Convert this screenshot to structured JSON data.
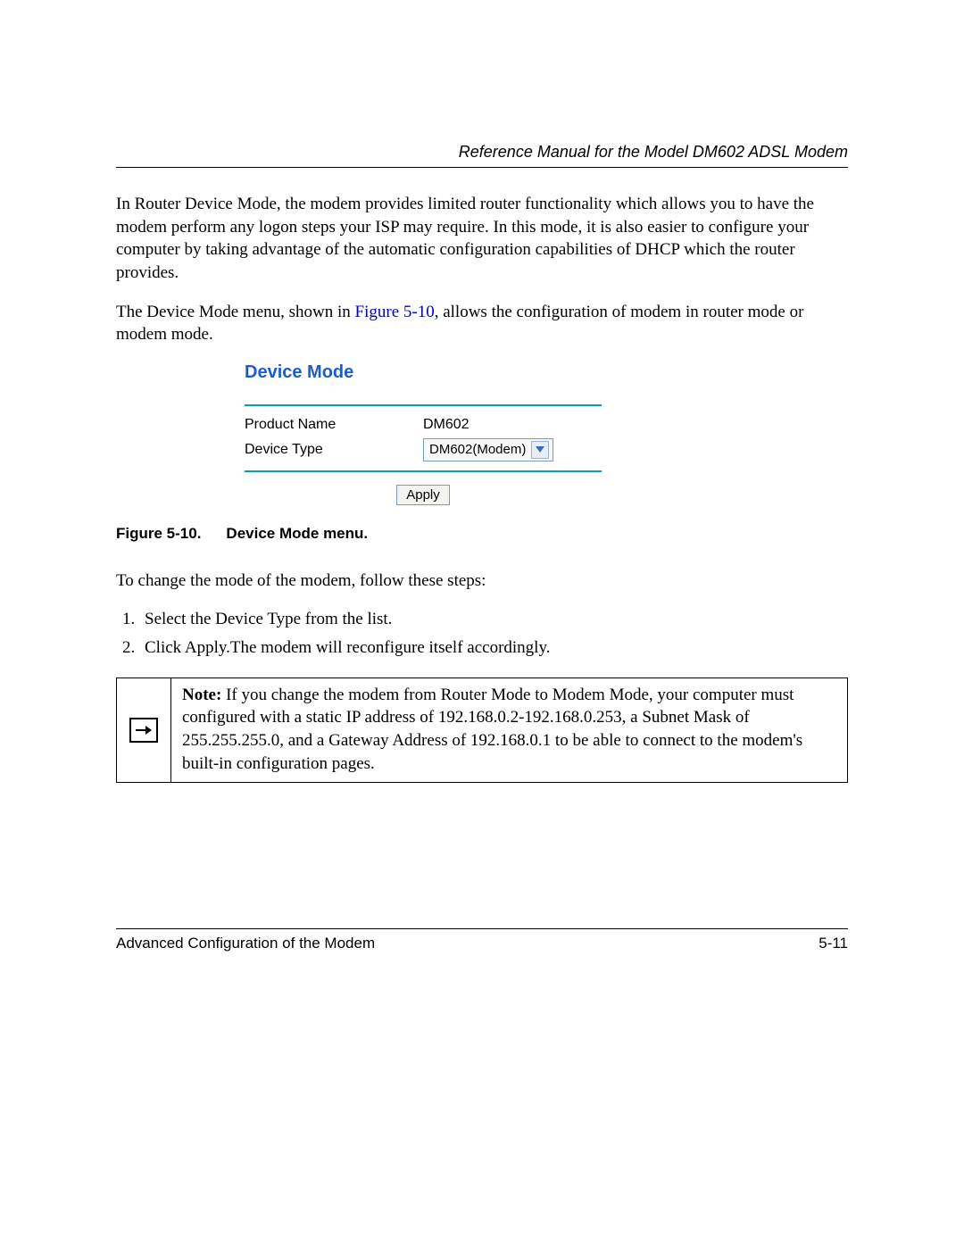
{
  "header": {
    "title": "Reference Manual for the Model DM602 ADSL Modem"
  },
  "body": {
    "p1": "In Router Device Mode, the modem provides limited router functionality which allows you to have the modem perform any logon steps your ISP may require. In this mode, it is also easier to configure your computer by taking advantage of the automatic configuration capabilities of DHCP which the router provides.",
    "p2_a": "The Device Mode menu, shown in ",
    "p2_link": "Figure 5-10",
    "p2_b": ", allows the configuration of modem in router mode or modem mode.",
    "p3": "To change the mode of the modem, follow these steps:",
    "steps": [
      "Select the Device Type from the list.",
      "Click Apply.The modem will reconfigure itself accordingly."
    ]
  },
  "screenshot": {
    "title": "Device Mode",
    "rows": {
      "product_name_label": "Product Name",
      "product_name_value": "DM602",
      "device_type_label": "Device Type",
      "device_type_value": "DM602(Modem)"
    },
    "apply": "Apply"
  },
  "figure": {
    "num": "Figure 5-10.",
    "caption": "Device Mode menu."
  },
  "note": {
    "label": "Note:",
    "text": " If you change the modem from Router Mode to Modem Mode, your computer must configured with a static IP address of 192.168.0.2-192.168.0.253, a Subnet Mask of 255.255.255.0, and a Gateway Address of 192.168.0.1 to be able to connect to the modem's built-in configuration pages."
  },
  "footer": {
    "left": "Advanced Configuration of the Modem",
    "right": "5-11"
  }
}
